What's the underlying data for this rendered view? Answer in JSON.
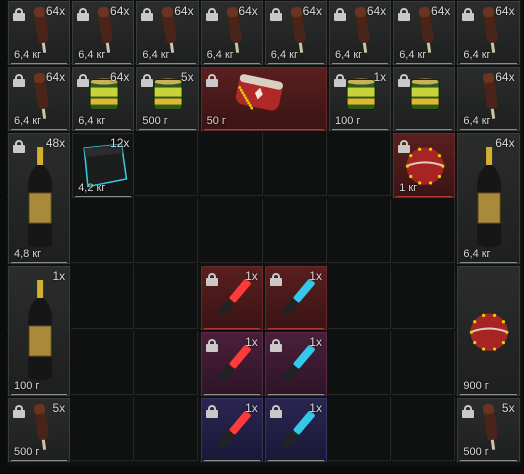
{
  "items": [
    {
      "id": "r0c0",
      "type": "chocolate",
      "qty": "64x",
      "weight": "6,4 кг",
      "lock": true
    },
    {
      "id": "r0c1",
      "type": "chocolate",
      "qty": "64x",
      "weight": "6,4 кг",
      "lock": true
    },
    {
      "id": "r0c2",
      "type": "chocolate",
      "qty": "64x",
      "weight": "6,4 кг",
      "lock": true
    },
    {
      "id": "r0c3",
      "type": "chocolate",
      "qty": "64x",
      "weight": "6,4 кг",
      "lock": true
    },
    {
      "id": "r0c4",
      "type": "chocolate",
      "qty": "64x",
      "weight": "6,4 кг",
      "lock": true
    },
    {
      "id": "r0c5",
      "type": "chocolate",
      "qty": "64x",
      "weight": "6,4 кг",
      "lock": true
    },
    {
      "id": "r0c6",
      "type": "chocolate",
      "qty": "64x",
      "weight": "6,4 кг",
      "lock": true
    },
    {
      "id": "r0c7",
      "type": "chocolate",
      "qty": "64x",
      "weight": "6,4 кг",
      "lock": true
    },
    {
      "id": "r1c0",
      "type": "chocolate",
      "qty": "64x",
      "weight": "6,4 кг",
      "lock": true
    },
    {
      "id": "r1c1",
      "type": "can",
      "qty": "64x",
      "weight": "6,4 кг",
      "lock": true
    },
    {
      "id": "r1c2",
      "type": "can",
      "qty": "5x",
      "weight": "500 г",
      "lock": true
    },
    {
      "id": "r1c3",
      "type": "hat",
      "qty": "",
      "weight": "50 г",
      "lock": true
    },
    {
      "id": "r1c5",
      "type": "can",
      "qty": "1x",
      "weight": "100 г",
      "lock": true
    },
    {
      "id": "r1c6",
      "type": "can",
      "qty": "",
      "weight": "",
      "lock": true
    },
    {
      "id": "r1c7",
      "type": "chocolate",
      "qty": "64x",
      "weight": "6,4 кг",
      "lock": false
    },
    {
      "id": "r2c0",
      "type": "champagne",
      "qty": "48x",
      "weight": "4,8 кг",
      "lock": true
    },
    {
      "id": "r2c1",
      "type": "box",
      "qty": "12x",
      "weight": "4,2 кг",
      "lock": false
    },
    {
      "id": "r2c6",
      "type": "ornament",
      "qty": "",
      "weight": "1 кг",
      "lock": true
    },
    {
      "id": "r2c7",
      "type": "champagne",
      "qty": "64x",
      "weight": "6,4 кг",
      "lock": false
    },
    {
      "id": "r4c0",
      "type": "champagne",
      "qty": "1x",
      "weight": "100 г",
      "lock": false
    },
    {
      "id": "r4c3",
      "type": "flare-red",
      "qty": "1x",
      "weight": "",
      "lock": true
    },
    {
      "id": "r4c4",
      "type": "flare-blue",
      "qty": "1x",
      "weight": "",
      "lock": true
    },
    {
      "id": "r4c7",
      "type": "ornament",
      "qty": "",
      "weight": "900 г",
      "lock": false
    },
    {
      "id": "r5c3",
      "type": "flare-red",
      "qty": "1x",
      "weight": "",
      "lock": true
    },
    {
      "id": "r5c4",
      "type": "flare-blue",
      "qty": "1x",
      "weight": "",
      "lock": true
    },
    {
      "id": "r6c0",
      "type": "chocolate",
      "qty": "5x",
      "weight": "500 г",
      "lock": true
    },
    {
      "id": "r6c3",
      "type": "flare-red",
      "qty": "1x",
      "weight": "",
      "lock": true
    },
    {
      "id": "r6c4",
      "type": "flare-blue",
      "qty": "1x",
      "weight": "",
      "lock": true
    },
    {
      "id": "r6c7",
      "type": "chocolate",
      "qty": "5x",
      "weight": "500 г",
      "lock": true
    }
  ],
  "colors": {
    "accent_red": "#b03a3a",
    "flare_red": "#ff3a3a",
    "flare_blue": "#35c8e8",
    "box_outline": "#35d0e0",
    "gold": "#e6d000"
  }
}
